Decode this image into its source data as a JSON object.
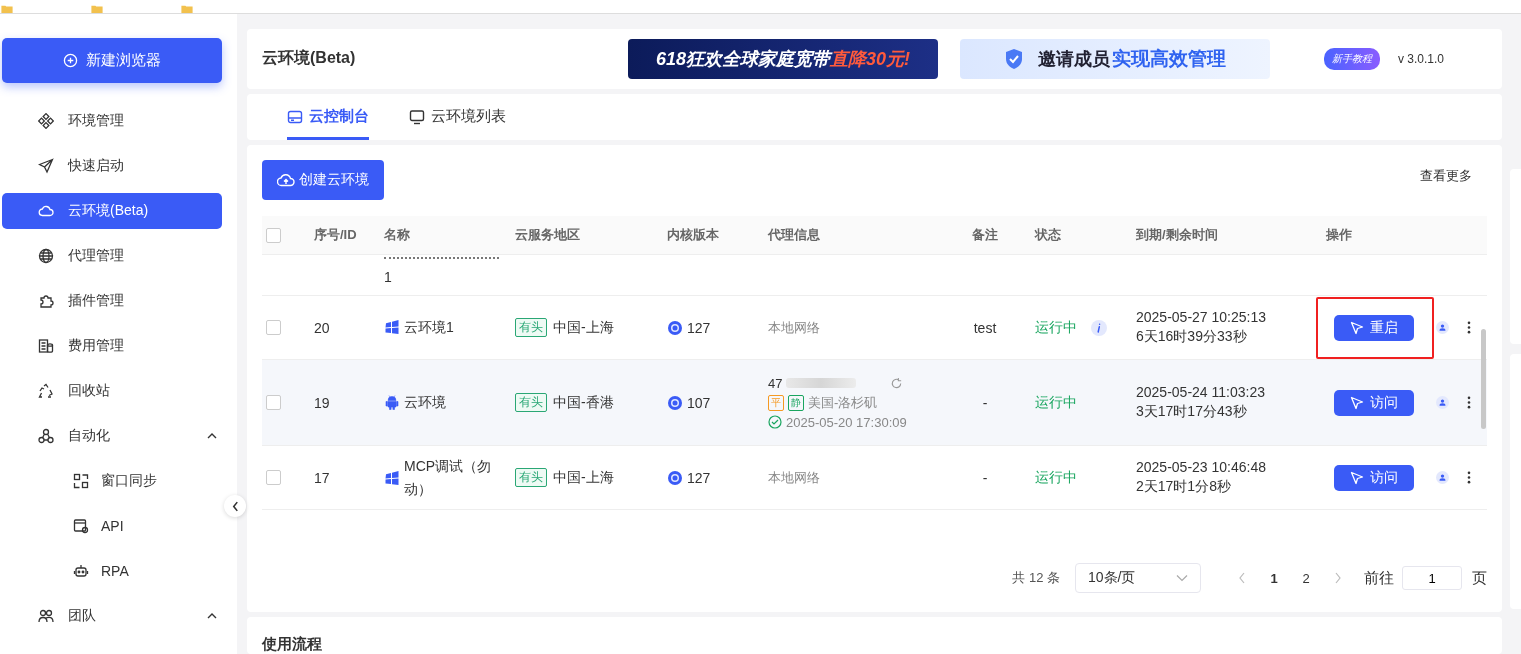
{
  "sidebar": {
    "new_button": "新建浏览器",
    "items": [
      {
        "label": "环境管理",
        "kind": "env",
        "selected": false
      },
      {
        "label": "快速启动",
        "kind": "launch",
        "selected": false
      },
      {
        "label": "云环境(Beta)",
        "kind": "cloud",
        "selected": true
      },
      {
        "label": "代理管理",
        "kind": "globe",
        "selected": false
      },
      {
        "label": "插件管理",
        "kind": "plugin",
        "selected": false
      },
      {
        "label": "费用管理",
        "kind": "billing",
        "selected": false
      },
      {
        "label": "回收站",
        "kind": "recycle",
        "selected": false
      },
      {
        "label": "自动化",
        "kind": "automation",
        "selected": false,
        "expanded": true,
        "children": [
          {
            "label": "窗口同步",
            "kind": "sync",
            "selected": false
          },
          {
            "label": "API",
            "kind": "api",
            "selected": false
          },
          {
            "label": "RPA",
            "kind": "robot",
            "selected": false
          }
        ]
      },
      {
        "label": "团队",
        "kind": "team",
        "selected": false,
        "expanded": true
      }
    ]
  },
  "header": {
    "title": "云环境(Beta)",
    "banners": [
      {
        "kind": "dark",
        "text": "618狂欢全球家庭宽带",
        "highlight": "直降30元!"
      },
      {
        "kind": "light",
        "text": "邀请成员",
        "highlight": "实现高效管理"
      }
    ],
    "tutorial": "新手教程",
    "version": "v 3.0.1.0"
  },
  "tabs": [
    {
      "label": "云控制台",
      "kind": "console",
      "selected": true
    },
    {
      "label": "云环境列表",
      "kind": "monitor",
      "selected": false
    }
  ],
  "create_button": "创建云环境",
  "view_more": "查看更多",
  "table": {
    "columns": [
      "序号/ID",
      "名称",
      "云服务地区",
      "内核版本",
      "代理信息",
      "备注",
      "状态",
      "到期/剩余时间",
      "操作"
    ],
    "select_all_checked": false,
    "rows": [
      {
        "kind": "partial",
        "name": "1"
      },
      {
        "kind": "windows",
        "checked": false,
        "id": "20",
        "name": "云环境1",
        "head_tag": "有头",
        "region": "中国-上海",
        "kernel": "127",
        "proxy": {
          "kind": "local",
          "text": "本地网络"
        },
        "note": "test",
        "status": "运行中",
        "info": true,
        "expiry": "2025-05-27 10:25:13",
        "remaining": "6天16时39分33秒",
        "action": "重启",
        "highlighted": true,
        "hovered": false
      },
      {
        "kind": "android",
        "checked": false,
        "id": "19",
        "name": "云环境",
        "head_tag": "有头",
        "region": "中国-香港",
        "kernel": "107",
        "proxy": {
          "kind": "ip",
          "ip": "47",
          "tags": [
            {
              "text": "平",
              "color": "#f59a23"
            },
            {
              "text": "静",
              "color": "#19a55f"
            }
          ],
          "location": "美国-洛杉矶",
          "checked": "2025-05-20 17:30:09"
        },
        "note": "-",
        "status": "运行中",
        "info": false,
        "expiry": "2025-05-24 11:03:23",
        "remaining": "3天17时17分43秒",
        "action": "访问",
        "highlighted": false,
        "hovered": true
      },
      {
        "kind": "windows",
        "checked": false,
        "id": "17",
        "name": "MCP调试（勿动）",
        "head_tag": "有头",
        "region": "中国-上海",
        "kernel": "127",
        "proxy": {
          "kind": "local",
          "text": "本地网络"
        },
        "note": "-",
        "status": "运行中",
        "info": false,
        "expiry": "2025-05-23 10:46:48",
        "remaining": "2天17时1分8秒",
        "action": "访问",
        "highlighted": false,
        "hovered": false
      }
    ]
  },
  "pagination": {
    "total": "共 12 条",
    "page_size": "10条/页",
    "pages": [
      {
        "label": "1",
        "selected": true
      },
      {
        "label": "2",
        "selected": false
      }
    ],
    "goto_label": "前往",
    "goto_value": "1",
    "goto_suffix": "页"
  },
  "bottom_card": {
    "title": "使用流程"
  }
}
